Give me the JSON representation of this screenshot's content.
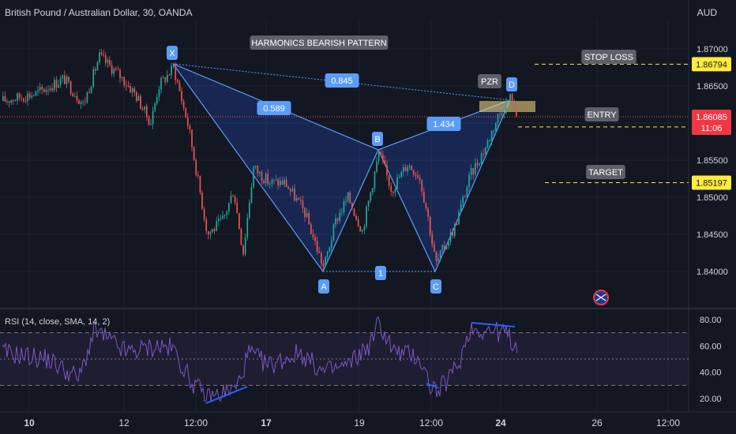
{
  "header": {
    "symbol": "British Pound / Australian Dollar, 30, OANDA",
    "currency": "AUD"
  },
  "rsi": {
    "label": "RSI (14, close, SMA, 14, 2)"
  },
  "chart_data": [
    {
      "type": "candlestick",
      "title": "HARMONICS BEARISH PATTERN",
      "ylim": [
        1.8375,
        1.8725
      ],
      "y_ticks": [
        "1.87000",
        "1.86500",
        "1.86000",
        "1.85500",
        "1.85000",
        "1.84500",
        "1.84000"
      ],
      "x_ticks": [
        "10",
        "12",
        "12:00",
        "17",
        "19",
        "12:00",
        "24",
        "26",
        "12:00"
      ],
      "x_ticks_bold": [
        "10",
        "17",
        "24"
      ],
      "pattern_points": [
        {
          "label": "X",
          "price": 1.868
        },
        {
          "label": "A",
          "price": 1.84
        },
        {
          "label": "B",
          "price": 1.8564
        },
        {
          "label": "C",
          "price": 1.84
        },
        {
          "label": "D",
          "price": 1.8631
        }
      ],
      "ratios": {
        "XB": "0.845",
        "XA_B": "0.589",
        "BC_D": "1.434",
        "AC": "1"
      },
      "zone_label": "PZR",
      "levels": [
        {
          "name": "STOP LOSS",
          "price": "1.86794",
          "color": "#ffeb3b"
        },
        {
          "name": "ENTRY",
          "price": "1.86012",
          "color": "#ffeb3b"
        },
        {
          "name": "TARGET",
          "price": "1.85197",
          "color": "#ffeb3b"
        }
      ],
      "last_price": "1.86085",
      "countdown": "11:06"
    },
    {
      "type": "line",
      "title": "RSI (14, close, SMA, 14, 2)",
      "ylim": [
        15,
        85
      ],
      "y_ticks": [
        "80.00",
        "60.00",
        "40.00",
        "20.00"
      ],
      "bands": [
        70,
        50,
        30
      ]
    }
  ],
  "colors": {
    "bg": "#131722",
    "up": "#26a69a",
    "down": "#ef5350",
    "pattern": "#5b9cf6",
    "rsi": "#7e57c2",
    "level": "#ffeb3b"
  }
}
